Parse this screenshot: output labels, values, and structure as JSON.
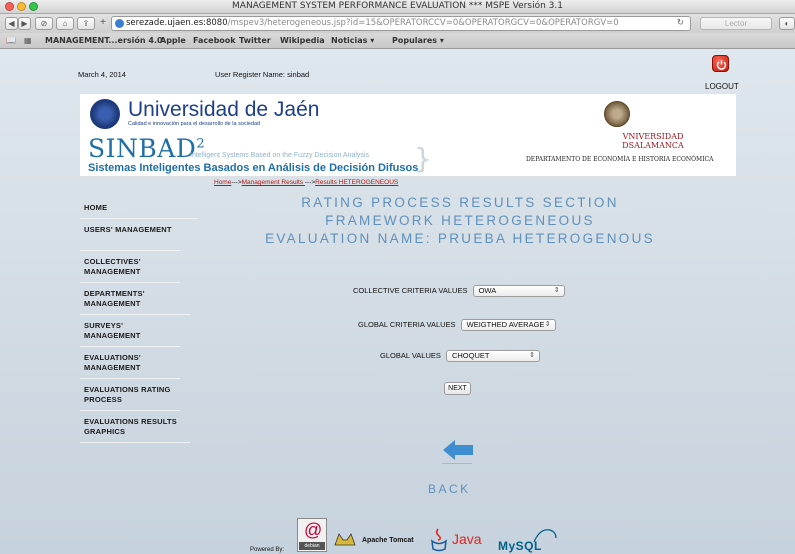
{
  "browser": {
    "window_title": "MANAGEMENT SYSTEM PERFORMANCE EVALUATION *** MSPE Versión 3.1",
    "url_host": "serezade.ujaen.es:8080",
    "url_path": "/mspev3/heterogeneous.jsp?id=15&OPERATORCCV=0&OPERATORGCV=0&OPERATORGV=0",
    "reader_label": "Lector",
    "bookmarks": [
      "MANAGEMENT...ersión 4.0",
      "Apple",
      "Facebook",
      "Twitter",
      "Wikipedia",
      "Noticias ▾",
      "Populares ▾"
    ]
  },
  "header": {
    "date": "March 4, 2014",
    "user_label": "User Register Name: sinbad",
    "logout_label": "LOGOUT"
  },
  "banner": {
    "uja_name": "Universidad de Jaén",
    "uja_subtitle": "Calidad e innovación para el desarrollo de la sociedad",
    "sinbad": "SINBAD",
    "sinbad_sup": "2",
    "sinbad_en": "Intelligent Systems Based on the Fuzzy Decision Analysis",
    "sinbad_es": "Sistemas Inteligentes Basados en Análisis de Decisión Difusos",
    "usal_line1": "VNIVERSIDAD",
    "usal_line2": "DSALAMANCA",
    "usal_dept": "DEPARTAMENTO DE ECONOMÍA E HISTORIA ECONÓMICA"
  },
  "breadcrumb": {
    "home": "Home",
    "sep1": "--->",
    "management": "Management Results ",
    "sep2": "--->",
    "current": "Results HETEROGENEOUS"
  },
  "sidebar": {
    "items": [
      {
        "label": "HOME"
      },
      {
        "label": "USERS' MANAGEMENT"
      },
      {
        "label": "COLLECTIVES' MANAGEMENT"
      },
      {
        "label": "DEPARTMENTS' MANAGEMENT"
      },
      {
        "label": "SURVEYS' MANAGEMENT"
      },
      {
        "label": "EVALUATIONS' MANAGEMENT"
      },
      {
        "label": "EVALUATIONS RATING PROCESS"
      },
      {
        "label": "EVALUATIONS RESULTS GRAPHICS"
      }
    ]
  },
  "main": {
    "heading1": "RATING PROCESS RESULTS SECTION",
    "heading2": "FRAMEWORK HETEROGENEOUS",
    "heading3": "EVALUATION NAME: PRUEBA HETEROGENOUS",
    "ccv_label": "COLLECTIVE CRITERIA VALUES",
    "ccv_value": "OWA",
    "gcv_label": "GLOBAL CRITERIA VALUES",
    "gcv_value": "WEIGTHED AVERAGE",
    "gv_label": "GLOBAL VALUES",
    "gv_value": "CHOQUET",
    "next_label": "NEXT",
    "back_label": "BACK"
  },
  "footer": {
    "powered_by": "Powered By:",
    "debian": "debian",
    "tomcat": "Apache Tomcat",
    "java": "Java",
    "mysql": "MySQL"
  },
  "colors": {
    "accent_blue": "#5f90bd",
    "breadcrumb_red": "#b11a14",
    "logout_red": "#c41b0f"
  }
}
